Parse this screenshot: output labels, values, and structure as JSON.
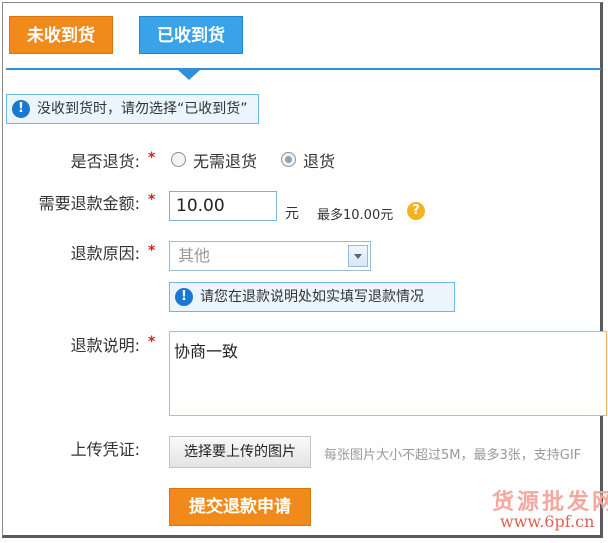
{
  "tabs": {
    "not_received": "未收到货",
    "received": "已收到货"
  },
  "notice": {
    "icon": "info-icon",
    "text": "没收到货时，请勿选择“已收到货”"
  },
  "form": {
    "required_mark": "*",
    "return": {
      "label": "是否退货:",
      "options": [
        "无需退货",
        "退货"
      ],
      "selected": "退货"
    },
    "amount": {
      "label": "需要退款金额:",
      "value": "10.00",
      "unit": "元",
      "max_text": "最多10.00元"
    },
    "reason": {
      "label": "退款原因:",
      "selected": "其他",
      "hint": "请您在退款说明处如实填写退款情况"
    },
    "description": {
      "label": "退款说明:",
      "value": "协商一致"
    },
    "proof": {
      "label": "上传凭证:",
      "button": "选择要上传的图片",
      "tip": "每张图片大小不超过5M，最多3张，支持GIF"
    },
    "submit": "提交退款申请"
  },
  "watermark": {
    "line1": "货源批发网",
    "line2": "www.6pf.cn"
  },
  "colors": {
    "orange": "#f08a1a",
    "blue": "#39a2e8",
    "required": "#d62020"
  }
}
